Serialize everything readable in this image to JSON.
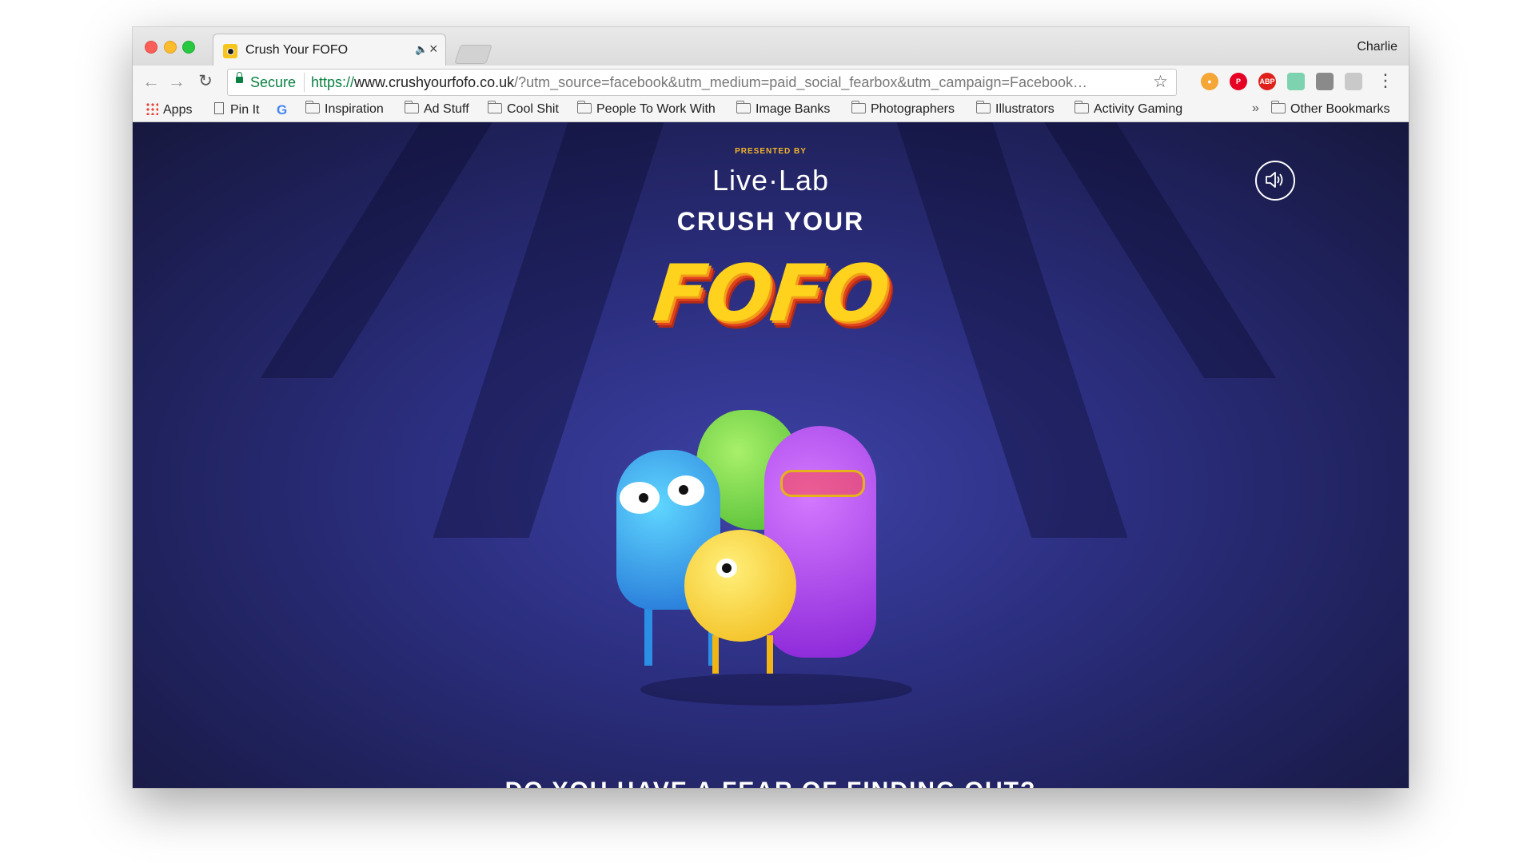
{
  "browser": {
    "tab_title": "Crush Your FOFO",
    "profile_name": "Charlie",
    "secure_label": "Secure",
    "url_scheme": "https://",
    "url_host": "www.crushyourfofo.co.uk",
    "url_path": "/?utm_source=facebook&utm_medium=paid_social_fearbox&utm_campaign=Facebook…",
    "extensions": [
      "ABP"
    ]
  },
  "bookmarks": [
    {
      "label": "Apps",
      "icon": "apps-grid-icon"
    },
    {
      "label": "Pin It",
      "icon": "page-icon"
    },
    {
      "label": "",
      "icon": "google-icon"
    },
    {
      "label": "Inspiration",
      "icon": "folder-icon"
    },
    {
      "label": "Ad Stuff",
      "icon": "folder-icon"
    },
    {
      "label": "Cool Shit",
      "icon": "folder-icon"
    },
    {
      "label": "People To Work With",
      "icon": "folder-icon"
    },
    {
      "label": "Image Banks",
      "icon": "folder-icon"
    },
    {
      "label": "Photographers",
      "icon": "folder-icon"
    },
    {
      "label": "Illustrators",
      "icon": "folder-icon"
    },
    {
      "label": "Activity Gaming",
      "icon": "folder-icon"
    },
    {
      "label": "Other Bookmarks",
      "icon": "folder-icon"
    }
  ],
  "page": {
    "presented_by": "PRESENTED BY",
    "brand": "Live·Lab",
    "headline": "CRUSH YOUR",
    "logo_word": "FOFO",
    "tagline": "DO YOU HAVE A FEAR OF FINDING OUT?"
  },
  "colors": {
    "accent_yellow": "#ffd21d",
    "background_navy": "#2c2f80",
    "secure_green": "#0b8043"
  }
}
